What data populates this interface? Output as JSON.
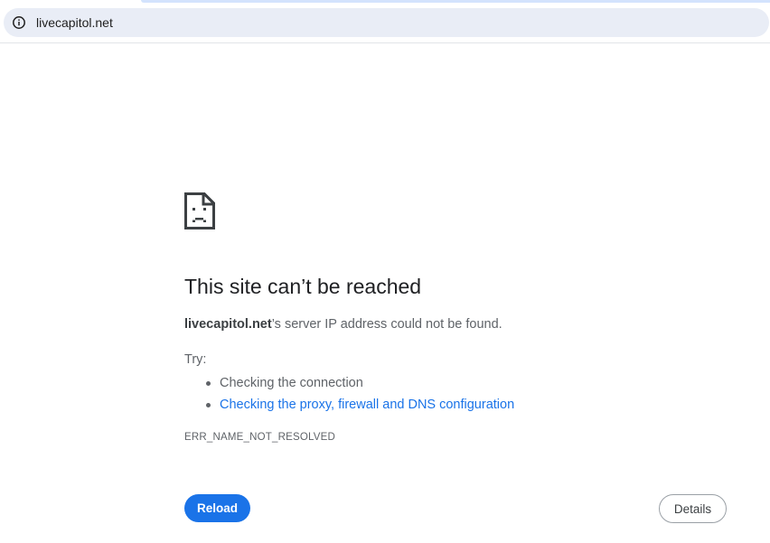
{
  "browser": {
    "url": "livecapitol.net",
    "site_info_icon": "info-circle-icon"
  },
  "error_page": {
    "icon": "sad-page-icon",
    "headline": "This site can’t be reached",
    "domain": "livecapitol.net",
    "description_suffix": "’s server IP address could not be found.",
    "try_label": "Try:",
    "suggestions": [
      "Checking the connection",
      "Checking the proxy, firewall and DNS configuration"
    ],
    "error_code": "ERR_NAME_NOT_RESOLVED",
    "reload_label": "Reload",
    "details_label": "Details"
  },
  "colors": {
    "accent": "#1a73e8",
    "omnibox_bg": "#e9edf6",
    "text_secondary": "#5f6368"
  }
}
